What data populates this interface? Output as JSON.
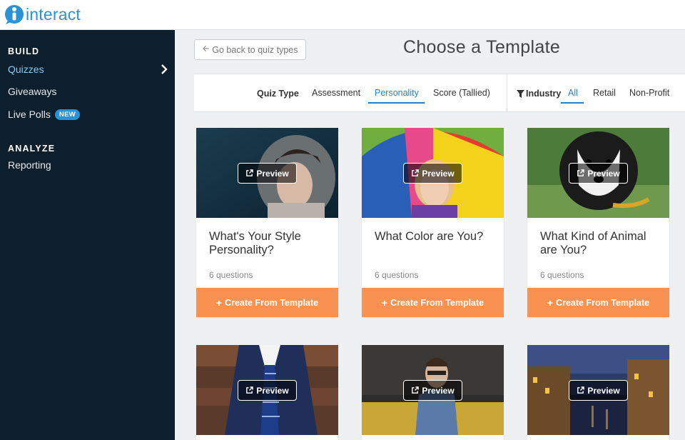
{
  "brand": {
    "name": "interact",
    "color": "#2a93d5"
  },
  "sidebar": {
    "sections": [
      {
        "heading": "BUILD",
        "items": [
          {
            "label": "Quizzes",
            "active": true
          },
          {
            "label": "Giveaways"
          },
          {
            "label": "Live Polls",
            "badge": "NEW"
          }
        ]
      },
      {
        "heading": "ANALYZE",
        "items": [
          {
            "label": "Reporting"
          }
        ]
      }
    ]
  },
  "header": {
    "back_label": "Go back to quiz types",
    "title": "Choose a Template"
  },
  "filters": {
    "quiz_type_label": "Quiz Type",
    "quiz_types": [
      "Assessment",
      "Personality",
      "Score (Tallied)"
    ],
    "quiz_type_selected": "Personality",
    "industry_label": "Industry",
    "industries": [
      "All",
      "Retail",
      "Non-Profit"
    ],
    "industry_selected": "All"
  },
  "templates": [
    {
      "title": "What's Your Style Personality?",
      "count": "6 questions",
      "preview": "Preview",
      "cta": "Create From Template"
    },
    {
      "title": "What Color are You?",
      "count": "6 questions",
      "preview": "Preview",
      "cta": "Create From Template"
    },
    {
      "title": "What Kind of Animal are You?",
      "count": "6 questions",
      "preview": "Preview",
      "cta": "Create From Template"
    },
    {
      "preview": "Preview"
    },
    {
      "preview": "Preview"
    },
    {
      "preview": "Preview"
    }
  ],
  "colors": {
    "accent": "#f99250",
    "sidebar_bg": "#0d1f2d",
    "active_link": "#2a80c0"
  }
}
